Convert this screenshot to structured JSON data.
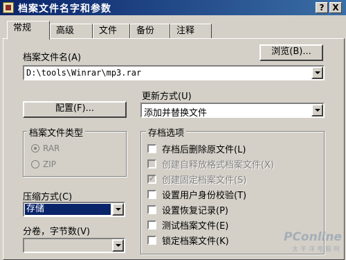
{
  "window": {
    "title": "档案文件名字和参数",
    "help_label": "?",
    "close_label": "X"
  },
  "tabs": [
    {
      "label": "常规"
    },
    {
      "label": "高级"
    },
    {
      "label": "文件"
    },
    {
      "label": "备份"
    },
    {
      "label": "注释"
    }
  ],
  "archive": {
    "name_label": "档案文件名(A)",
    "browse_label": "浏览(B)...",
    "path_value": "D:\\tools\\Winrar\\mp3.rar"
  },
  "update": {
    "label": "更新方式(U)",
    "value": "添加并替换文件"
  },
  "config_label": "配置(F)...",
  "archive_type": {
    "title": "档案文件类型",
    "options": [
      {
        "label": "RAR",
        "selected": true
      },
      {
        "label": "ZIP",
        "selected": false
      }
    ]
  },
  "compression": {
    "label": "压缩方式(C)",
    "value": "存储"
  },
  "volume": {
    "label": "分卷，字节数(V)",
    "value": ""
  },
  "options": {
    "title": "存档选项",
    "items": [
      {
        "label": "存档后删除原文件(L)",
        "checked": false,
        "enabled": true
      },
      {
        "label": "创建自释放格式档案文件(X)",
        "checked": false,
        "enabled": false
      },
      {
        "label": "创建固定档案文件(S)",
        "checked": true,
        "enabled": false
      },
      {
        "label": "设置用户身份校验(T)",
        "checked": false,
        "enabled": true
      },
      {
        "label": "设置恢复记录(P)",
        "checked": false,
        "enabled": true
      },
      {
        "label": "测试档案文件(E)",
        "checked": false,
        "enabled": true
      },
      {
        "label": "锁定档案文件(K)",
        "checked": false,
        "enabled": true
      }
    ]
  },
  "watermark": {
    "main": "PConline",
    "sub": "太平洋电脑网"
  }
}
